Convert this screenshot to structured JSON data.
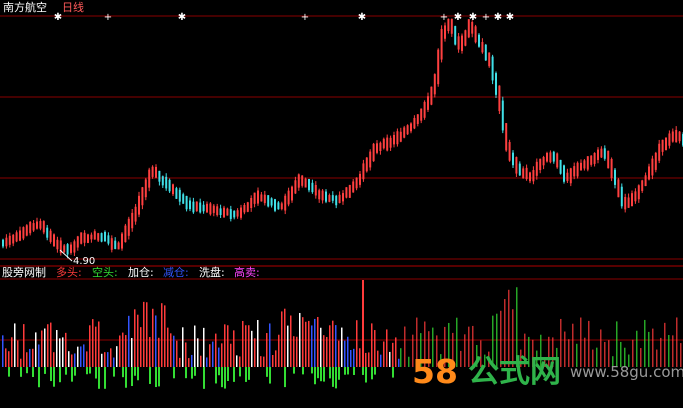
{
  "header": {
    "stock_name": "南方航空",
    "period": "日线",
    "name_color": "#ffffff",
    "period_color": "#ff5a5a"
  },
  "price_panel": {
    "low_annotation": "4.90",
    "signal_marks": [
      {
        "symbol": "✱"
      },
      {
        "symbol": "+"
      },
      {
        "symbol": "✱"
      },
      {
        "symbol": "+"
      },
      {
        "symbol": "✱"
      },
      {
        "symbol": "+"
      },
      {
        "symbol": "✱"
      },
      {
        "symbol": "✱"
      },
      {
        "symbol": "+"
      },
      {
        "symbol": "✱"
      },
      {
        "symbol": "✱"
      }
    ]
  },
  "indicator_panel": {
    "name": "股旁网制",
    "legend": [
      {
        "label": "多头:",
        "color": "#ff3b3b"
      },
      {
        "label": "空头:",
        "color": "#33dd33"
      },
      {
        "label": "加仓:",
        "color": "#ffffff"
      },
      {
        "label": "减仓:",
        "color": "#3355ff"
      },
      {
        "label": "洗盘:",
        "color": "#ffffff"
      },
      {
        "label": "高卖:",
        "color": "#ff44ff"
      }
    ]
  },
  "watermark": {
    "number": "58",
    "chinese": "公式网",
    "url": "www.58gu.com"
  },
  "colors": {
    "background": "#000000",
    "up": "#ff4040",
    "down": "#40e0e8",
    "grid": "#8a0000",
    "bull_bar": "#ff3b3b",
    "bear_bar": "#33dd33",
    "add_bar": "#ffffff",
    "reduce_bar": "#3355ff"
  }
}
